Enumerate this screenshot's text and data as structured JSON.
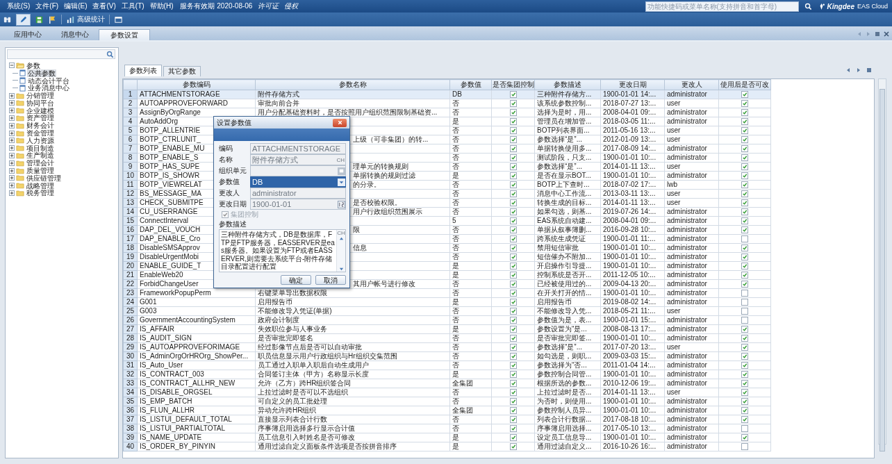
{
  "menu": [
    "系统(S)",
    "文件(F)",
    "编辑(E)",
    "查看(V)",
    "工具(T)",
    "帮助(H)"
  ],
  "service_period": "服务有效期 2020-08-06",
  "license_links": [
    "许可证",
    "侵权"
  ],
  "search": {
    "placeholder": "功能快捷码或菜单名称(支持拼音和首字母)"
  },
  "logo": {
    "brand": "Kingdee",
    "product": "EAS Cloud"
  },
  "toolbar": {
    "stats_button": "高级统计"
  },
  "tabs": [
    {
      "label": "应用中心",
      "selected": false
    },
    {
      "label": "消息中心",
      "selected": false
    },
    {
      "label": "参数设置",
      "selected": true
    }
  ],
  "tree": [
    {
      "label": "参数",
      "expanded": true,
      "children": [
        {
          "label": "公共参数",
          "selected": true
        },
        {
          "label": "动态会计平台",
          "selected": false
        },
        {
          "label": "业务消息中心",
          "selected": false
        }
      ]
    },
    {
      "label": "分销管理",
      "expanded": false
    },
    {
      "label": "协同平台",
      "expanded": false
    },
    {
      "label": "企业建模",
      "expanded": false
    },
    {
      "label": "资产管理",
      "expanded": false
    },
    {
      "label": "财务会计",
      "expanded": false
    },
    {
      "label": "资金管理",
      "expanded": false
    },
    {
      "label": "人力资源",
      "expanded": false
    },
    {
      "label": "项目制造",
      "expanded": false
    },
    {
      "label": "生产制造",
      "expanded": false
    },
    {
      "label": "管理会计",
      "expanded": false
    },
    {
      "label": "质量管理",
      "expanded": false
    },
    {
      "label": "供应链管理",
      "expanded": false
    },
    {
      "label": "战略管理",
      "expanded": false
    },
    {
      "label": "税务管理",
      "expanded": false
    }
  ],
  "subtabs": [
    {
      "label": "参数列表",
      "selected": true
    },
    {
      "label": "其它参数",
      "selected": false
    }
  ],
  "table": {
    "columns": [
      "参数编码",
      "参数名称",
      "参数值",
      "是否集团控制",
      "参数描述",
      "更改日期",
      "更改人",
      "使用后是否可改"
    ],
    "rows": [
      {
        "no": "1",
        "code": "ATTACHMENTSTORAGE",
        "name": "附件存储方式",
        "value": "DB",
        "group_control": true,
        "description": "三种附件存储方...",
        "date": "1900-01-01 14:...",
        "user": "administrator",
        "editable": true,
        "selected": true
      },
      {
        "no": "2",
        "code": "AUTOAPPROVEFORWARD",
        "name": "审批向前合并",
        "value": "否",
        "group_control": true,
        "description": "该系统参数控制...",
        "date": "2018-07-27 13:...",
        "user": "user",
        "editable": true,
        "selected": false
      },
      {
        "no": "3",
        "code": "AssignByOrgRange",
        "name": "用户分配基础资料时，是否按照用户组织范围限制基础资...",
        "value": "否",
        "group_control": true,
        "description": "选择为是时，用...",
        "date": "2008-04-01 09:...",
        "user": "administrator",
        "editable": true,
        "selected": false
      },
      {
        "no": "4",
        "code": "AutoAddOrg",
        "value": "是",
        "group_control": true,
        "description": "管理员在增加管...",
        "date": "2018-03-05 11:...",
        "user": "administrator",
        "editable": true,
        "selected": false
      },
      {
        "no": "5",
        "code": "BOTP_ALLENTRIE",
        "value": "否",
        "group_control": true,
        "description": "BOTP列表界面...",
        "date": "2011-05-16 13:...",
        "user": "user",
        "editable": true,
        "selected": false
      },
      {
        "no": "6",
        "code": "BOTP_CTRLUNIT_",
        "name": "上级（可非集团）的转...",
        "value": "否",
        "group_control": true,
        "description": "参数选择“是”...",
        "date": "2012-01-09 13:...",
        "user": "user",
        "editable": true,
        "selected": false
      },
      {
        "no": "7",
        "code": "BOTP_ENABLE_MU",
        "value": "否",
        "group_control": true,
        "description": "单据转换使用多...",
        "date": "2017-08-09 14:...",
        "user": "administrator",
        "editable": true,
        "selected": false
      },
      {
        "no": "8",
        "code": "BOTP_ENABLE_S",
        "value": "否",
        "group_control": true,
        "description": "测试阶段，只支...",
        "date": "1900-01-01 10:...",
        "user": "administrator",
        "editable": true,
        "selected": false
      },
      {
        "no": "9",
        "code": "BOTP_HAS_SUPE",
        "name": "理单元的转换规则",
        "value": "否",
        "group_control": true,
        "description": "参数选择“是”...",
        "date": "2014-01-11 13:...",
        "user": "user",
        "editable": true,
        "selected": false
      },
      {
        "no": "10",
        "code": "BOTP_IS_SHOWR",
        "name": "单据转换的规则过滤",
        "value": "是",
        "group_control": true,
        "description": "是否在显示BOT...",
        "date": "1900-01-01 10:...",
        "user": "administrator",
        "editable": true,
        "selected": false
      },
      {
        "no": "11",
        "code": "BOTP_VIEWRELAT",
        "name": "的分录。",
        "value": "否",
        "group_control": true,
        "description": "BOTP上下查时...",
        "date": "2018-07-02 17:...",
        "user": "lwb",
        "editable": true,
        "selected": false
      },
      {
        "no": "12",
        "code": "BS_MESSAGE_MA",
        "value": "否",
        "group_control": true,
        "description": "消息中心工作流...",
        "date": "2013-03-11 13:...",
        "user": "user",
        "editable": true,
        "selected": false
      },
      {
        "no": "13",
        "code": "CHECK_SUBMITPE",
        "name": "是否校验权限。",
        "value": "否",
        "group_control": true,
        "description": "转换生成的目标...",
        "date": "2014-01-11 13:...",
        "user": "user",
        "editable": true,
        "selected": false
      },
      {
        "no": "14",
        "code": "CU_USERRANGE",
        "name": "用户行政组织范围展示",
        "value": "否",
        "group_control": true,
        "description": "如果勾选，则基...",
        "date": "2019-07-26 14:...",
        "user": "administrator",
        "editable": true,
        "selected": false
      },
      {
        "no": "15",
        "code": "ConnectInterval",
        "value": "5",
        "group_control": true,
        "description": "EAS系统自动建...",
        "date": "2008-04-01 09:...",
        "user": "administrator",
        "editable": true,
        "selected": false
      },
      {
        "no": "16",
        "code": "DAP_DEL_VOUCH",
        "name": "限",
        "value": "否",
        "group_control": true,
        "description": "单据从叙事簿删...",
        "date": "2016-09-28 10:...",
        "user": "administrator",
        "editable": true,
        "selected": false
      },
      {
        "no": "17",
        "code": "DAP_ENABLE_Cro",
        "value": "否",
        "group_control": true,
        "description": "跨系统生成凭证",
        "date": "1900-01-01 11:...",
        "user": "administrator",
        "editable": false,
        "selected": false
      },
      {
        "no": "18",
        "code": "DisableSMSApprov",
        "name": "信息",
        "value": "否",
        "group_control": true,
        "description": "禁用短信审批",
        "date": "1900-01-01 10:...",
        "user": "administrator",
        "editable": true,
        "selected": false
      },
      {
        "no": "19",
        "code": "DisableUrgentMobi",
        "value": "否",
        "group_control": true,
        "description": "短信催办不附加...",
        "date": "1900-01-01 10:...",
        "user": "administrator",
        "editable": true,
        "selected": false
      },
      {
        "no": "20",
        "code": "ENABLE_GUIDE_T",
        "value": "是",
        "group_control": true,
        "description": "开启操作引导提...",
        "date": "1900-01-01 10:...",
        "user": "administrator",
        "editable": true,
        "selected": false
      },
      {
        "no": "21",
        "code": "EnableWeb20",
        "value": "是",
        "group_control": true,
        "description": "控制系统是否开...",
        "date": "2011-12-05 10:...",
        "user": "administrator",
        "editable": true,
        "selected": false
      },
      {
        "no": "22",
        "code": "ForbidChangeUser",
        "name": "其用户帐号进行修改",
        "value": "否",
        "group_control": true,
        "description": "已经被使用过的...",
        "date": "2009-04-13 20:...",
        "user": "administrator",
        "editable": true,
        "selected": false
      },
      {
        "no": "23",
        "code": "FrameworkPopupPerm",
        "name": "右键菜单导出数据权限",
        "value": "否",
        "group_control": true,
        "description": "在开关打开的情...",
        "date": "1900-01-01 10:...",
        "user": "administrator",
        "editable": false,
        "selected": false
      },
      {
        "no": "24",
        "code": "G001",
        "name": "启用报告币",
        "value": "是",
        "group_control": true,
        "description": "启用报告币",
        "date": "2019-08-02 14:...",
        "user": "administrator",
        "editable": false,
        "selected": false
      },
      {
        "no": "25",
        "code": "G003",
        "name": "不能修改导入凭证(单据)",
        "value": "否",
        "group_control": true,
        "description": "不能修改导入凭...",
        "date": "2018-05-21 11:...",
        "user": "user",
        "editable": false,
        "selected": false
      },
      {
        "no": "26",
        "code": "GovernmentAccountingSystem",
        "name": "政府会计制度",
        "value": "否",
        "group_control": true,
        "description": "参数值为是，表...",
        "date": "1900-01-01 15:...",
        "user": "administrator",
        "editable": false,
        "selected": false
      },
      {
        "no": "27",
        "code": "IS_AFFAIR",
        "name": "失效职位参与人事业务",
        "value": "是",
        "group_control": true,
        "description": "参数设置为“是...",
        "date": "2008-08-13 17:...",
        "user": "administrator",
        "editable": true,
        "selected": false
      },
      {
        "no": "28",
        "code": "IS_AUDIT_SIGN",
        "name": "是否审批完即签名",
        "value": "否",
        "group_control": true,
        "description": "是否审批完即签...",
        "date": "1900-01-01 10:...",
        "user": "administrator",
        "editable": true,
        "selected": false
      },
      {
        "no": "29",
        "code": "IS_AUTOAPPROVEFORIMAGE",
        "name": "经过影像节点后是否可以自动审批",
        "value": "否",
        "group_control": true,
        "description": "参数选择“是”...",
        "date": "2017-07-20 13:...",
        "user": "user",
        "editable": true,
        "selected": false
      },
      {
        "no": "30",
        "code": "IS_AdminOrgOrHROrg_ShowPer...",
        "name": "职员信息显示用户行政组织与Hr组织交集范围",
        "value": "否",
        "group_control": true,
        "description": "如勾选是，则职...",
        "date": "2009-03-03 15:...",
        "user": "administrator",
        "editable": true,
        "selected": false
      },
      {
        "no": "31",
        "code": "IS_Auto_User",
        "name": "员工通过入职单入职后自动生成用户",
        "value": "否",
        "group_control": true,
        "description": "参数选择为“否...",
        "date": "2011-01-04 14:...",
        "user": "administrator",
        "editable": true,
        "selected": false
      },
      {
        "no": "32",
        "code": "IS_CONTRACT_003",
        "name": "合同签订主体（甲方）名称显示长度",
        "value": "是",
        "group_control": true,
        "description": "参数控制合同管...",
        "date": "1900-01-01 10:...",
        "user": "administrator",
        "editable": true,
        "selected": false
      },
      {
        "no": "33",
        "code": "IS_CONTRACT_ALLHR_NEW",
        "name": "允许（乙方）跨HR组织签合同",
        "value": "全集团",
        "group_control": true,
        "description": "根据所选的参数...",
        "date": "2010-12-06 19:...",
        "user": "administrator",
        "editable": true,
        "selected": false
      },
      {
        "no": "34",
        "code": "IS_DISABLE_ORGSEL",
        "name": "上拉过滤时是否可以不选组织",
        "value": "否",
        "group_control": true,
        "description": "上拉过滤时是否...",
        "date": "2014-01-11 13:...",
        "user": "user",
        "editable": true,
        "selected": false
      },
      {
        "no": "35",
        "code": "IS_EMP_BATCH",
        "name": "可自定义的员工批处理",
        "value": "否",
        "group_control": true,
        "description": "为否时，则使用...",
        "date": "1900-01-01 10:...",
        "user": "administrator",
        "editable": true,
        "selected": false
      },
      {
        "no": "36",
        "code": "IS_FLUN_ALLHR",
        "name": "异动允许跨HR组织",
        "value": "全集团",
        "group_control": true,
        "description": "参数控制人员异...",
        "date": "1900-01-01 10:...",
        "user": "administrator",
        "editable": true,
        "selected": false
      },
      {
        "no": "37",
        "code": "IS_LISTUI_DEFAULT_TOTAL",
        "name": "直接显示列表合计行数",
        "value": "否",
        "group_control": true,
        "description": "列表合计行数据...",
        "date": "2017-08-18 10:...",
        "user": "administrator",
        "editable": true,
        "selected": false
      },
      {
        "no": "38",
        "code": "IS_LISTUI_PARTIALTOTAL",
        "name": "序事簿启用选择多行显示合计值",
        "value": "否",
        "group_control": true,
        "description": "序事簿启用选择...",
        "date": "2017-05-10 13:...",
        "user": "administrator",
        "editable": false,
        "selected": false
      },
      {
        "no": "39",
        "code": "IS_NAME_UPDATE",
        "name": "员工信息引入时姓名是否可修改",
        "value": "是",
        "group_control": true,
        "description": "设定员工信息导...",
        "date": "1900-01-01 10:...",
        "user": "administrator",
        "editable": true,
        "selected": false
      },
      {
        "no": "40",
        "code": "IS_ORDER_BY_PINYIN",
        "name": "通用过滤自定义面板条件选项是否按拼音排序",
        "value": "是",
        "group_control": true,
        "description": "通用过滤自定义...",
        "date": "2016-10-26 16:...",
        "user": "administrator",
        "editable": false,
        "selected": false
      }
    ]
  },
  "dialog": {
    "title": "设置参数值",
    "fields": [
      {
        "label": "编码",
        "kind": "text",
        "value": "ATTACHMENTSTORAGE",
        "disabled": true
      },
      {
        "label": "名称",
        "kind": "lang",
        "value": "附件存储方式",
        "lang": "CH",
        "disabled": true
      },
      {
        "label": "组织单元",
        "kind": "lookup",
        "disabled": true
      },
      {
        "label": "参数值",
        "kind": "select",
        "value": "DB",
        "disabled": false
      },
      {
        "label": "更改人",
        "kind": "text",
        "value": "administrator",
        "disabled": true
      },
      {
        "label": "更改日期",
        "kind": "date",
        "value": "1900-01-01",
        "disabled": true
      }
    ],
    "group_control": {
      "label": "集团控制",
      "checked": true
    },
    "description": {
      "label": "参数描述",
      "lang": "CH",
      "text": "三种附件存储方式，DB是数据库，FTP是FTP服务器，EASSERVER是eas服务器。如果设置为FTP或者EASSERVER,则需要去系统平台-附件存储目录配置进行配置"
    },
    "buttons": [
      "确定",
      "取消"
    ]
  }
}
